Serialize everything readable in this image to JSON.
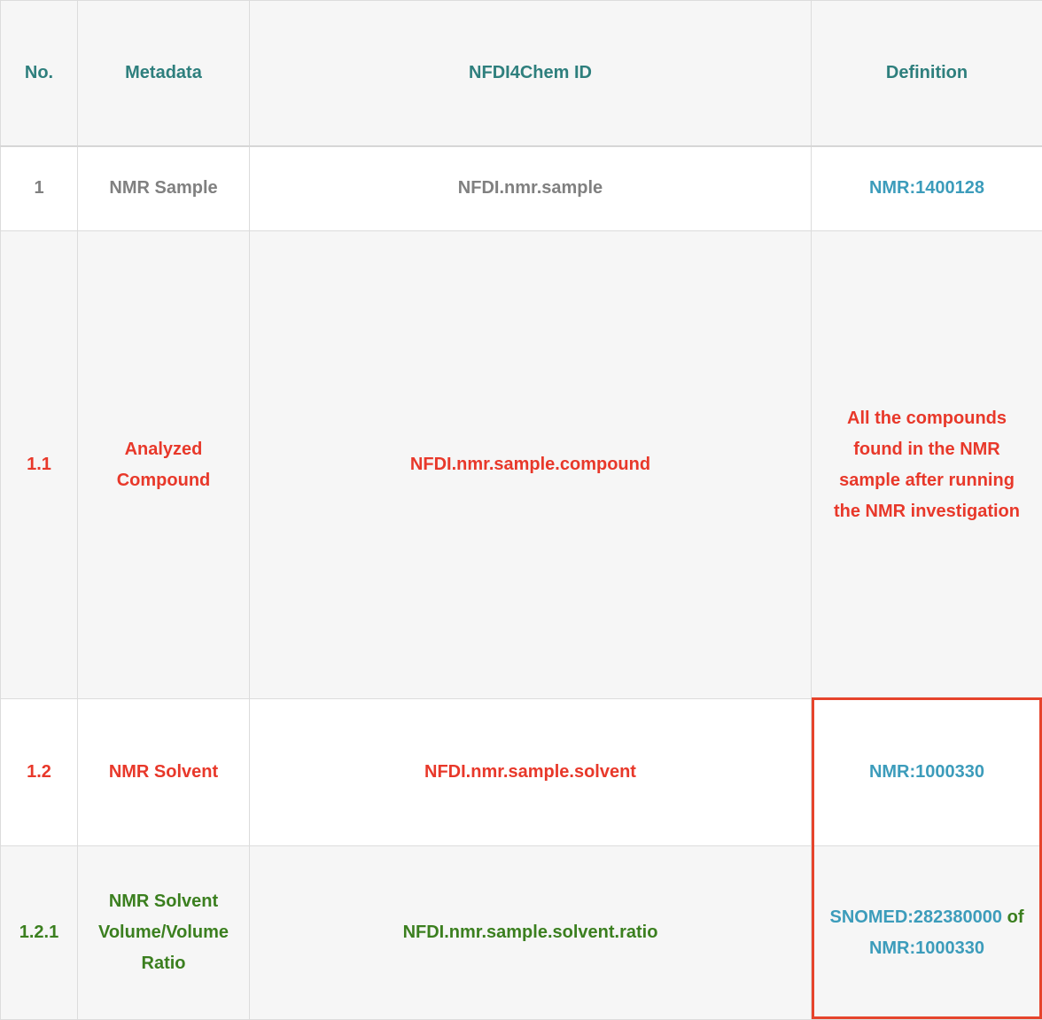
{
  "headers": [
    "No.",
    "Metadata",
    "NFDI4Chem ID",
    "Definition"
  ],
  "rows": [
    {
      "no": "1",
      "metadata": "NMR Sample",
      "id": "NFDI.nmr.sample",
      "definition": "NMR:1400128"
    },
    {
      "no": "1.1",
      "metadata": "Analyzed Compound",
      "id": "NFDI.nmr.sample.compound",
      "definition": "All the compounds found in the NMR sample after running the NMR investigation"
    },
    {
      "no": "1.2",
      "metadata": "NMR Solvent",
      "id": "NFDI.nmr.sample.solvent",
      "definition": "NMR:1000330"
    },
    {
      "no": "1.2.1",
      "metadata": "NMR Solvent Volume/Volume Ratio",
      "id": "NFDI.nmr.sample.solvent.ratio",
      "definition_parts": [
        "SNOMED:282380000",
        "of",
        "NMR:1000330"
      ]
    }
  ],
  "colors": {
    "header": "#2e7f7d",
    "level1": "#808080",
    "level2": "#e8382a",
    "level3": "#3b7f1f",
    "link": "#3c9cbb",
    "highlight": "#e6442c"
  }
}
